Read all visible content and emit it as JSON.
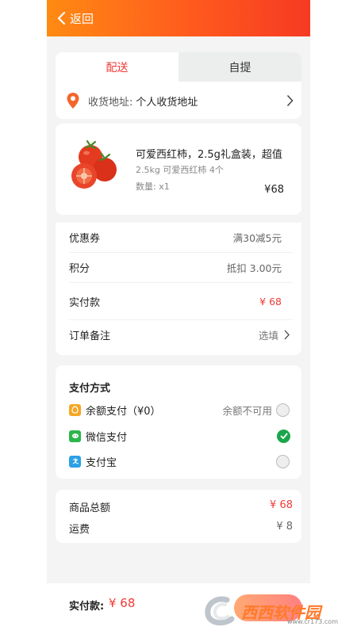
{
  "header": {
    "back_label": "返回"
  },
  "delivery": {
    "tabs": [
      "配送",
      "自提"
    ],
    "address_label": "收货地址:",
    "address_value": "个人收货地址"
  },
  "product": {
    "title": "可爱西红柿，2.5g礼盒装，超值",
    "spec": "2.5kg  可爱西红柿 4个",
    "quantity": "数量:  x1",
    "price": "¥68"
  },
  "info": {
    "coupon_label": "优惠券",
    "coupon_value": "满30减5元",
    "points_label": "积分",
    "points_value": "抵扣 3.00元",
    "paid_label": "实付款",
    "paid_value": "¥ 68",
    "remark_label": "订单备注",
    "remark_value": "选填"
  },
  "payment": {
    "title": "支付方式",
    "balance_label": "余额支付（¥0）",
    "balance_note": "余额不可用",
    "wechat_label": "微信支付",
    "alipay_label": "支付宝",
    "selected": "微信支付"
  },
  "totals": {
    "goods_label": "商品总额",
    "goods_value": "¥ 68",
    "shipping_label": "运费",
    "shipping_value": "¥ 8"
  },
  "bottom": {
    "pay_label": "实付款:",
    "pay_amount": "¥ 68"
  },
  "watermark": {
    "text": "西西软件园",
    "sub": "www.cr173.com"
  },
  "colors": {
    "accent": "#ef3b35",
    "header_start": "#ff8a12",
    "header_end": "#f63a22",
    "checked": "#1aa64a"
  }
}
